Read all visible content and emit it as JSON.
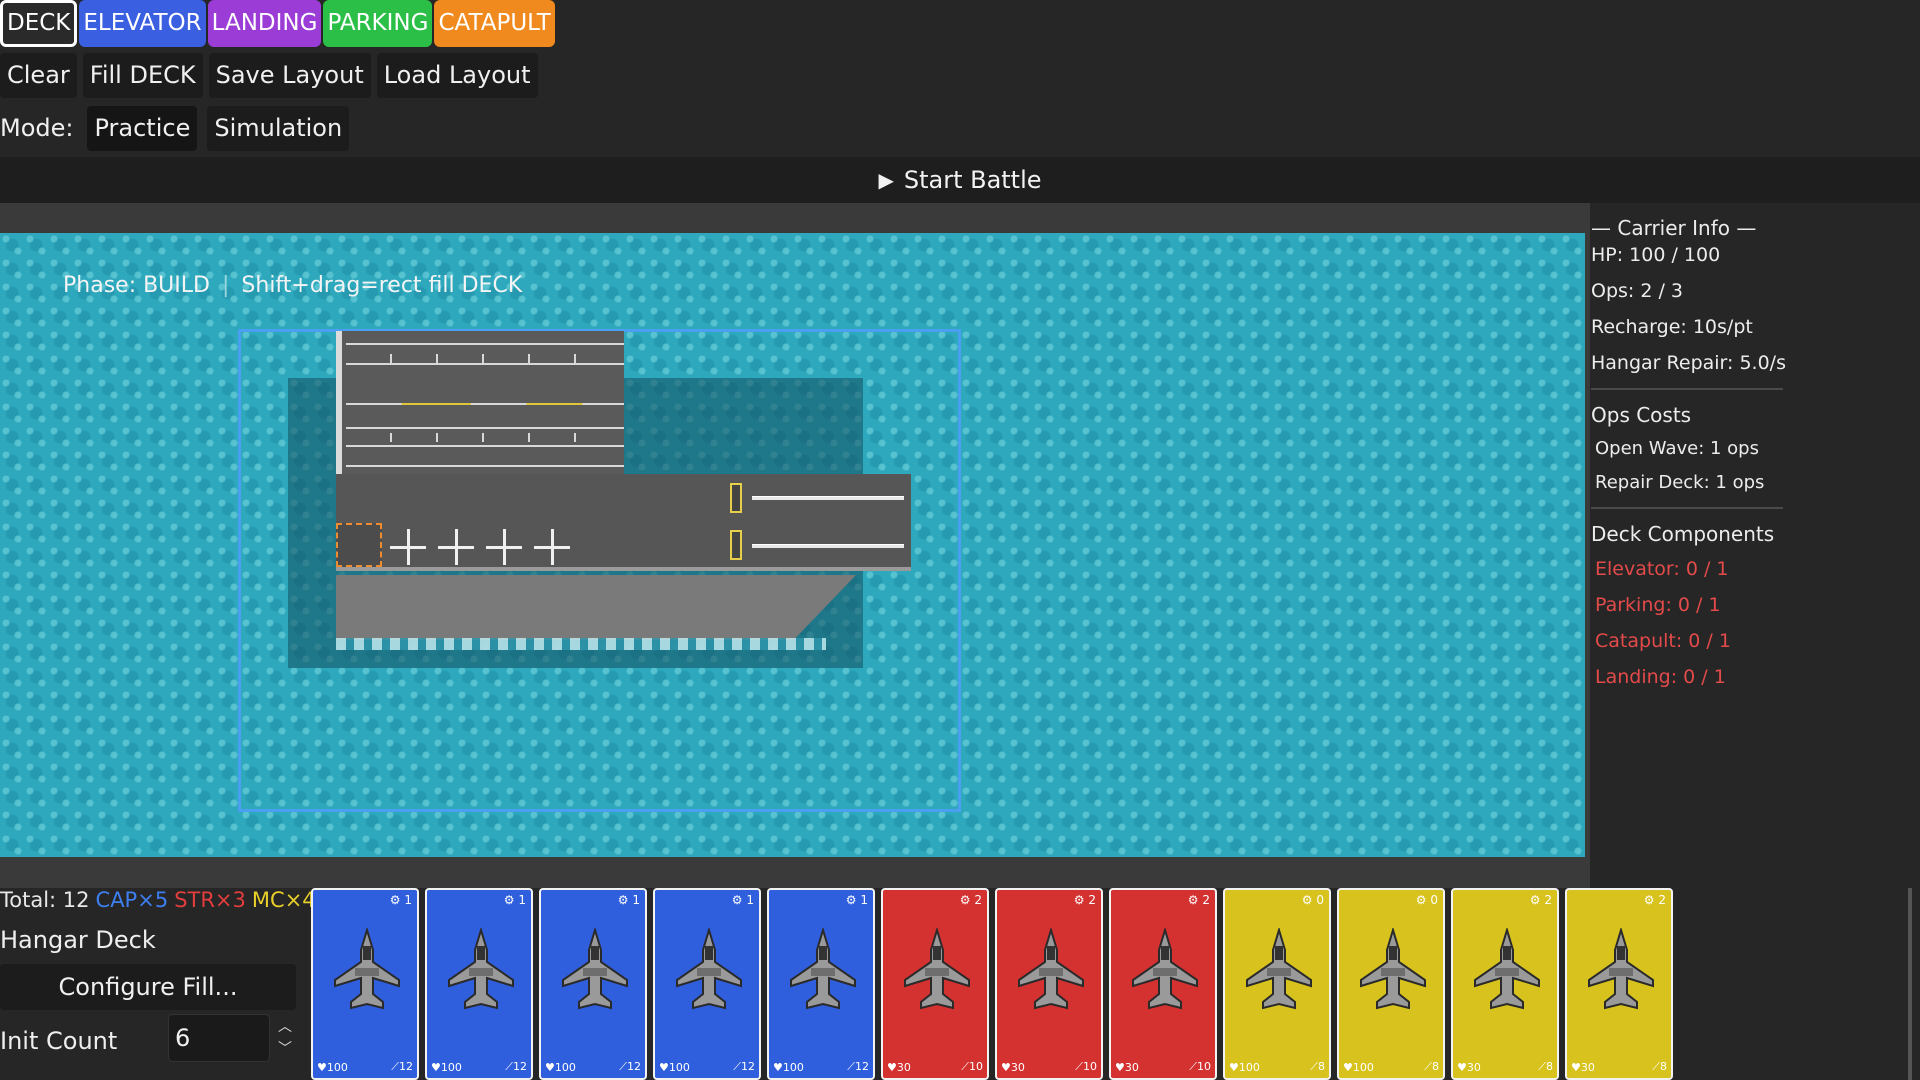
{
  "tabs": [
    {
      "label": "DECK",
      "color": "#2a2a2a",
      "selected": true
    },
    {
      "label": "ELEVATOR",
      "color": "#3a5fe0"
    },
    {
      "label": "LANDING",
      "color": "#9b3cd6"
    },
    {
      "label": "PARKING",
      "color": "#2bbf47"
    },
    {
      "label": "CATAPULT",
      "color": "#f08a1e"
    }
  ],
  "toolbar": {
    "clear": "Clear",
    "fill": "Fill DECK",
    "save": "Save Layout",
    "load": "Load Layout"
  },
  "mode": {
    "label": "Mode:",
    "practice": "Practice",
    "simulation": "Simulation"
  },
  "start": {
    "icon": "▶",
    "label": "Start Battle"
  },
  "game": {
    "phase": "Phase: BUILD",
    "separator": "|",
    "hint": "Shift+drag=rect fill DECK"
  },
  "side": {
    "title": "— Carrier Info —",
    "hp": "HP: 100 / 100",
    "ops": "Ops: 2 / 3",
    "recharge": "Recharge: 10s/pt",
    "hangar_repair": "Hangar Repair: 5.0/s",
    "ops_costs_title": "Ops Costs",
    "open_wave": "Open Wave: 1 ops",
    "repair_deck": "Repair Deck: 1 ops",
    "deck_components_title": "Deck Components",
    "elevator": "Elevator: 0 / 1",
    "parking": "Parking: 0 / 1",
    "catapult": "Catapult: 0 / 1",
    "landing": "Landing: 0 / 1"
  },
  "bottom": {
    "total": "Total: 12",
    "cap": "CAP×5",
    "str": "STR×3",
    "mc": "MC×4",
    "hangar": "Hangar Deck",
    "configure": "Configure Fill...",
    "init_label": "Init Count",
    "init_value": "6"
  },
  "cards": [
    {
      "type": "cap",
      "cost": "1",
      "hp": "100",
      "atk": "12"
    },
    {
      "type": "cap",
      "cost": "1",
      "hp": "100",
      "atk": "12"
    },
    {
      "type": "cap",
      "cost": "1",
      "hp": "100",
      "atk": "12"
    },
    {
      "type": "cap",
      "cost": "1",
      "hp": "100",
      "atk": "12"
    },
    {
      "type": "cap",
      "cost": "1",
      "hp": "100",
      "atk": "12"
    },
    {
      "type": "str",
      "cost": "2",
      "hp": "30",
      "atk": "10"
    },
    {
      "type": "str",
      "cost": "2",
      "hp": "30",
      "atk": "10"
    },
    {
      "type": "str",
      "cost": "2",
      "hp": "30",
      "atk": "10"
    },
    {
      "type": "mc",
      "cost": "0",
      "hp": "100",
      "atk": "8"
    },
    {
      "type": "mc",
      "cost": "0",
      "hp": "100",
      "atk": "8"
    },
    {
      "type": "mc",
      "cost": "2",
      "hp": "30",
      "atk": "8"
    },
    {
      "type": "mc",
      "cost": "2",
      "hp": "30",
      "atk": "8"
    }
  ]
}
